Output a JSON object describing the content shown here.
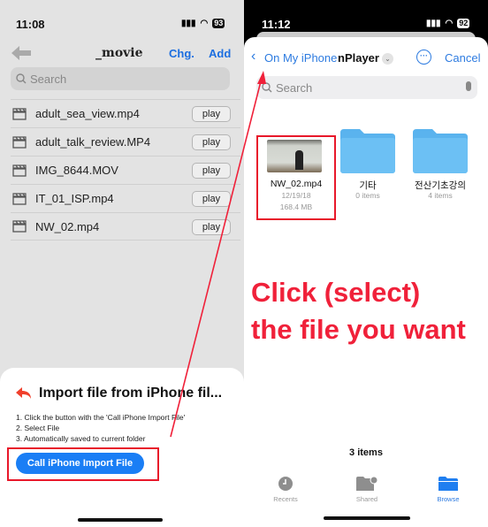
{
  "left": {
    "status": {
      "time": "11:08",
      "battery": "93"
    },
    "nav": {
      "title": "_movie",
      "chg_label": "Chg.",
      "add_label": "Add"
    },
    "search": {
      "placeholder": "Search"
    },
    "files": [
      {
        "name": "adult_sea_view.mp4",
        "action": "play"
      },
      {
        "name": "adult_talk_review.MP4",
        "action": "play"
      },
      {
        "name": "IMG_8644.MOV",
        "action": "play"
      },
      {
        "name": "IT_01_ISP.mp4",
        "action": "play"
      },
      {
        "name": "NW_02.mp4",
        "action": "play"
      }
    ],
    "sheet": {
      "title": "Import file from iPhone fil...",
      "steps": [
        "1. Click the button with the 'Call iPhone Import File'",
        "2. Select File",
        "3. Automatically saved to current folder"
      ],
      "button_label": "Call iPhone Import File"
    }
  },
  "right": {
    "status": {
      "time": "11:12",
      "battery": "92"
    },
    "nav": {
      "back_label": "On My iPhone",
      "folder": "nPlayer",
      "cancel_label": "Cancel"
    },
    "search": {
      "placeholder": "Search"
    },
    "items": [
      {
        "name": "NW_02.mp4",
        "date": "12/19/18",
        "size": "168.4 MB"
      },
      {
        "name": "기타",
        "meta": "0 items"
      },
      {
        "name": "전산기초강의",
        "meta": "4 items"
      }
    ],
    "count": "3 items",
    "tabs": [
      {
        "label": "Recents"
      },
      {
        "label": "Shared"
      },
      {
        "label": "Browse",
        "active": true
      }
    ],
    "accent": "#2d7be0"
  },
  "annotation": {
    "line1": "Click (select)",
    "line2": "the file you want",
    "color": "#f0213a"
  }
}
